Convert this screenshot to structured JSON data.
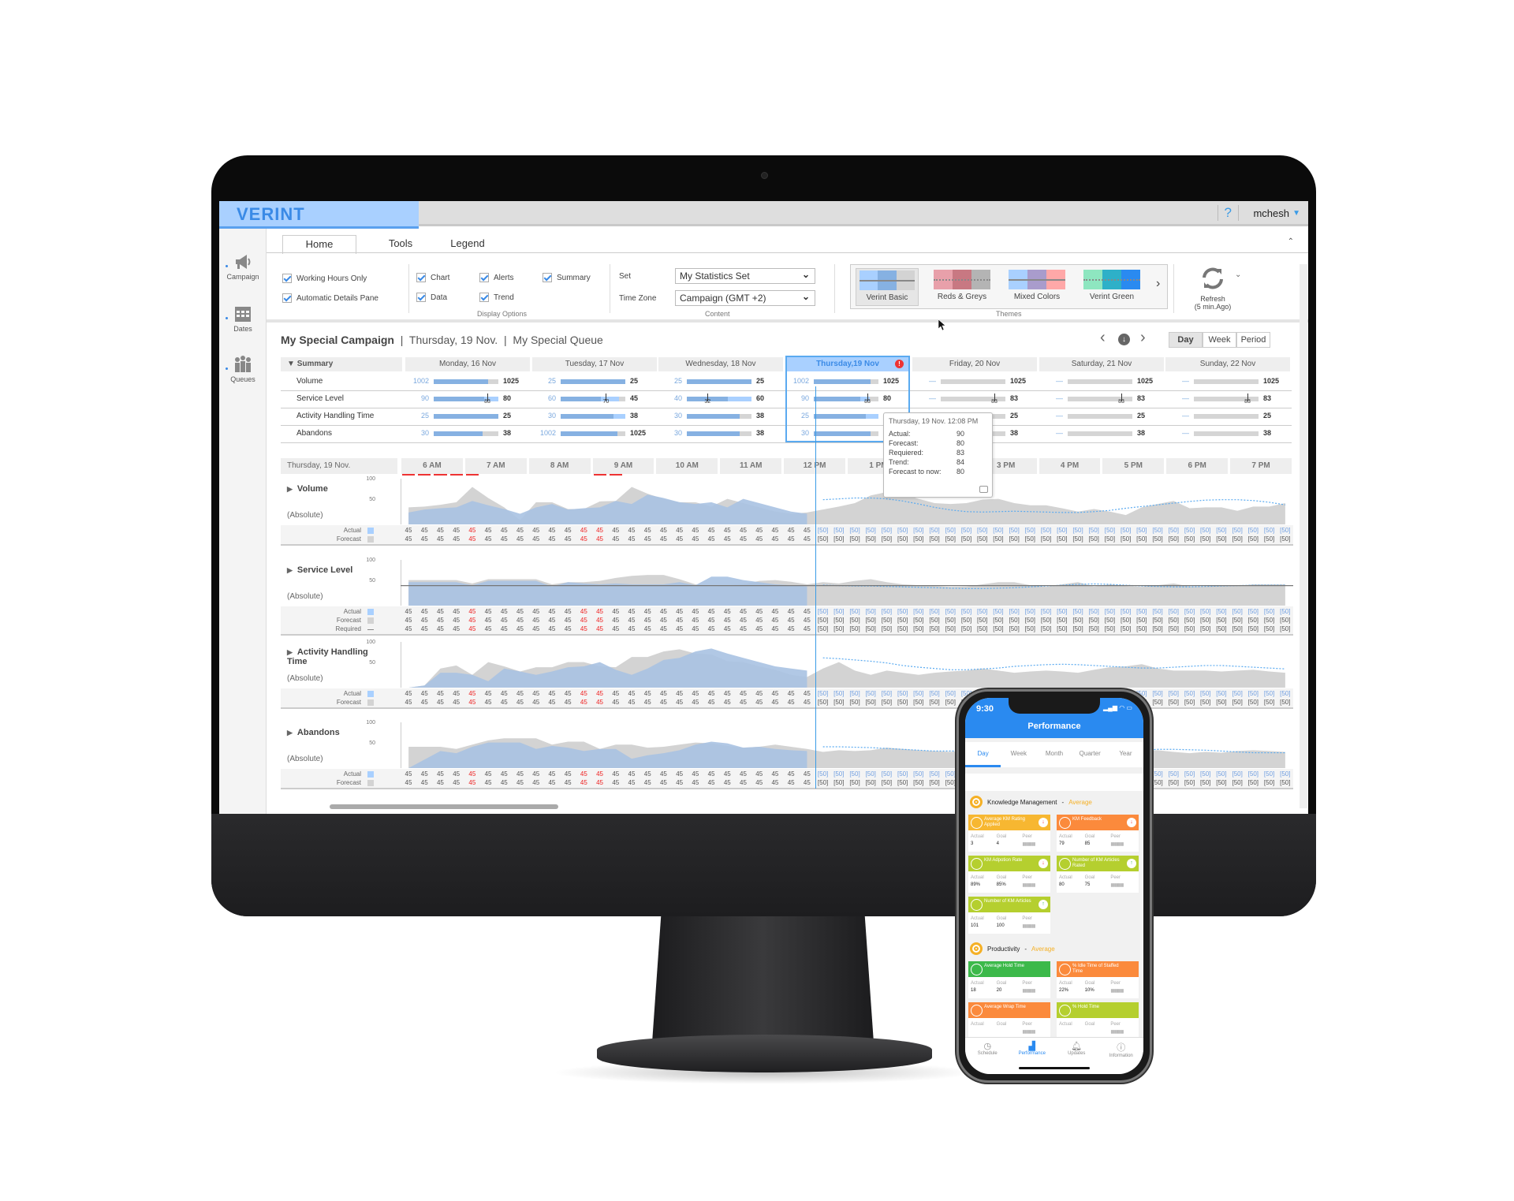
{
  "header": {
    "brand": "VERINT",
    "help": "?",
    "user": "mchesh"
  },
  "sidebar": {
    "items": [
      {
        "label": "Campaign",
        "icon": "megaphone-icon"
      },
      {
        "label": "Dates",
        "icon": "calendar-icon"
      },
      {
        "label": "Queues",
        "icon": "people-icon"
      }
    ]
  },
  "tabs": [
    {
      "label": "Home",
      "active": true
    },
    {
      "label": "Tools"
    },
    {
      "label": "Legend"
    }
  ],
  "options": {
    "working_hours": "Working Hours Only",
    "auto_details": "Automatic Details Pane",
    "display": {
      "chart": "Chart",
      "alerts": "Alerts",
      "summary": "Summary",
      "data": "Data",
      "trend": "Trend",
      "group": "Display Options"
    },
    "content": {
      "set_label": "Set",
      "set_value": "My Statistics Set",
      "tz_label": "Time Zone",
      "tz_value": "Campaign (GMT +2)",
      "group": "Content"
    },
    "themes": {
      "group": "Themes",
      "items": [
        {
          "name": "Verint Basic",
          "colors": [
            "#a9d0ff",
            "#86b1e2",
            "#d3d3d3"
          ],
          "selected": true
        },
        {
          "name": "Reds & Greys",
          "colors": [
            "#e8a0aa",
            "#c87882",
            "#b4b4b4"
          ]
        },
        {
          "name": "Mixed Colors",
          "colors": [
            "#a9d0ff",
            "#a99ccc",
            "#ffa8a8"
          ]
        },
        {
          "name": "Verint Green",
          "colors": [
            "#8ee6c0",
            "#2eb0c8",
            "#2a8af0"
          ]
        }
      ]
    },
    "refresh": {
      "label": "Refresh",
      "sub": "(5 min.Ago)"
    }
  },
  "title": {
    "campaign": "My Special Campaign",
    "date": "Thursday, 19 Nov.",
    "queue": "My Special Queue"
  },
  "view_buttons": [
    {
      "label": "Day",
      "active": true
    },
    {
      "label": "Week"
    },
    {
      "label": "Period"
    }
  ],
  "summary": {
    "label": "Summary",
    "days": [
      "Monday, 16 Nov",
      "Tuesday, 17 Nov",
      "Wednesday, 18 Nov",
      "Thursday,19 Nov",
      "Friday, 20 Nov",
      "Saturday, 21 Nov",
      "Sunday, 22 Nov"
    ],
    "selected_day": 3,
    "rows": [
      {
        "label": "Volume",
        "cells": [
          {
            "l": "1002",
            "r": "1025",
            "fill": 0.84
          },
          {
            "l": "25",
            "r": "25",
            "fill": 1
          },
          {
            "l": "25",
            "r": "25",
            "fill": 1
          },
          {
            "l": "1002",
            "r": "1025",
            "fill": 0.88
          },
          {
            "l": "—",
            "r": "1025",
            "fill": 0
          },
          {
            "l": "—",
            "r": "1025",
            "fill": 0
          },
          {
            "l": "—",
            "r": "1025",
            "fill": 0
          }
        ]
      },
      {
        "label": "Service Level",
        "cells": [
          {
            "l": "90",
            "r": "80",
            "fill": 0.78,
            "req": "83",
            "light": 1
          },
          {
            "l": "60",
            "r": "45",
            "fill": 0.62,
            "req": "70",
            "light": 0.9
          },
          {
            "l": "40",
            "r": "60",
            "fill": 0.64,
            "req": "32",
            "light": 1
          },
          {
            "l": "90",
            "r": "80",
            "fill": 0.72,
            "req": "83",
            "light": 0.86
          },
          {
            "l": "—",
            "r": "83",
            "fill": 0,
            "req": "83"
          },
          {
            "l": "—",
            "r": "83",
            "fill": 0,
            "req": "83"
          },
          {
            "l": "—",
            "r": "83",
            "fill": 0,
            "req": "83"
          }
        ]
      },
      {
        "label": "Activity Handling Time",
        "cells": [
          {
            "l": "25",
            "r": "25",
            "fill": 1
          },
          {
            "l": "30",
            "r": "38",
            "fill": 0.82,
            "light": 1
          },
          {
            "l": "30",
            "r": "38",
            "fill": 0.82
          },
          {
            "l": "25",
            "r": "25",
            "fill": 0.8,
            "light": 1
          },
          {
            "l": "—",
            "r": "25",
            "fill": 0
          },
          {
            "l": "—",
            "r": "25",
            "fill": 0
          },
          {
            "l": "—",
            "r": "25",
            "fill": 0
          }
        ]
      },
      {
        "label": "Abandons",
        "cells": [
          {
            "l": "30",
            "r": "38",
            "fill": 0.75
          },
          {
            "l": "1002",
            "r": "1025",
            "fill": 0.88
          },
          {
            "l": "30",
            "r": "38",
            "fill": 0.82
          },
          {
            "l": "30",
            "r": "38",
            "fill": 0.88
          },
          {
            "l": "—",
            "r": "38",
            "fill": 0
          },
          {
            "l": "—",
            "r": "38",
            "fill": 0
          },
          {
            "l": "—",
            "r": "38",
            "fill": 0
          }
        ]
      }
    ]
  },
  "tooltip": {
    "title": "Thursday, 19 Nov. 12:08 PM",
    "rows": [
      {
        "k": "Actual:",
        "v": "90"
      },
      {
        "k": "Forecast:",
        "v": "80"
      },
      {
        "k": "Requiered:",
        "v": "83"
      },
      {
        "k": "Trend:",
        "v": "84"
      },
      {
        "k": "Forecast to now:",
        "v": "80"
      }
    ]
  },
  "timeline": {
    "date": "Thursday, 19 Nov.",
    "hours": [
      "6 AM",
      "7 AM",
      "8 AM",
      "9 AM",
      "10 AM",
      "11 AM",
      "12 PM",
      "1 PM",
      "2 PM",
      "3 PM",
      "4 PM",
      "5 PM",
      "6 PM",
      "7 PM"
    ],
    "alert_intervals": [
      0,
      1,
      2,
      3,
      4,
      12,
      13
    ]
  },
  "data_rows": {
    "past": [
      "45",
      "45",
      "45",
      "45",
      "45",
      "45",
      "45",
      "45",
      "45",
      "45",
      "45",
      "45",
      "45",
      "45",
      "45",
      "45",
      "45",
      "45",
      "45",
      "45",
      "45",
      "45",
      "45",
      "45",
      "45",
      "45"
    ],
    "future": [
      "[50]",
      "[50]",
      "[50]",
      "[50]",
      "[50]",
      "[50]",
      "[50]",
      "[50]",
      "[50]",
      "[50]",
      "[50]",
      "[50]",
      "[50]",
      "[50]",
      "[50]",
      "[50]",
      "[50]",
      "[50]",
      "[50]",
      "[50]",
      "[50]",
      "[50]",
      "[50]",
      "[50]",
      "[50]",
      "[50]",
      "[50]",
      "[50]",
      "[50]",
      "[50]"
    ],
    "highlight_indices": [
      4,
      11,
      12
    ],
    "labels": {
      "actual": "Actual",
      "forecast": "Forecast",
      "required": "Required"
    }
  },
  "charts": [
    {
      "title": "Volume",
      "unit": "(Absolute)",
      "y_ticks": [
        "100",
        "50"
      ],
      "rows": [
        "actual",
        "forecast"
      ],
      "forecast": [
        40,
        42,
        46,
        52,
        88,
        62,
        40,
        10,
        52,
        52,
        36,
        36,
        54,
        55,
        88,
        72,
        60,
        52,
        52,
        42,
        60,
        50,
        40,
        30,
        25,
        28,
        35,
        42,
        50,
        68,
        76,
        72,
        60,
        50,
        48,
        50,
        58,
        60,
        50,
        45,
        45,
        38,
        30,
        36,
        30,
        22,
        40,
        48,
        55,
        38,
        40,
        40,
        32,
        42,
        42,
        50
      ],
      "actual": [
        28,
        35,
        38,
        40,
        55,
        45,
        36,
        25,
        40,
        48,
        35,
        38,
        40,
        55,
        48,
        70,
        62,
        52,
        48,
        52,
        40,
        60,
        50,
        40,
        30,
        25
      ],
      "trend": [
        58,
        60,
        62,
        62,
        60,
        55,
        48,
        40,
        34,
        30,
        29,
        30,
        31,
        30,
        29,
        28,
        28,
        30,
        33,
        38,
        42,
        46,
        50,
        54,
        57,
        58,
        58,
        56,
        52,
        46
      ]
    },
    {
      "title": "Service Level",
      "unit": "(Absolute)",
      "y_ticks": [
        "100",
        "50"
      ],
      "rows": [
        "actual",
        "forecast",
        "required"
      ],
      "required_level": 47,
      "forecast": [
        60,
        60,
        60,
        60,
        52,
        62,
        62,
        62,
        62,
        50,
        55,
        55,
        58,
        65,
        70,
        72,
        72,
        62,
        50,
        45,
        48,
        50,
        58,
        60,
        56,
        50,
        55,
        52,
        58,
        62,
        55,
        50,
        48,
        46,
        44,
        45,
        50,
        55,
        55,
        48,
        44,
        50,
        55,
        45,
        50,
        46,
        44,
        48,
        52,
        45,
        45,
        48,
        46,
        50,
        50,
        50
      ],
      "actual": [
        55,
        55,
        55,
        55,
        48,
        58,
        58,
        58,
        58,
        45,
        55,
        52,
        50,
        52,
        50,
        50,
        50,
        55,
        48,
        68,
        68,
        60,
        55,
        50,
        48,
        45
      ],
      "trend": [
        48,
        47,
        46,
        46,
        45,
        44,
        43,
        42,
        41,
        40,
        40,
        41,
        42,
        44,
        46,
        48,
        50,
        51,
        50,
        48,
        46,
        45,
        44,
        44,
        45,
        46,
        47,
        48,
        48,
        48
      ]
    },
    {
      "title": "Activity Handling Time",
      "unit": "(Absolute)",
      "y_ticks": [
        "100",
        "50"
      ],
      "rows": [
        "actual",
        "forecast"
      ],
      "forecast": [
        0,
        5,
        45,
        52,
        30,
        60,
        50,
        38,
        48,
        48,
        60,
        60,
        50,
        48,
        72,
        72,
        85,
        90,
        80,
        78,
        62,
        60,
        50,
        42,
        30,
        25,
        45,
        60,
        40,
        30,
        40,
        35,
        30,
        35,
        38,
        40,
        45,
        40,
        35,
        38,
        40,
        38,
        35,
        42,
        48,
        50,
        55,
        45,
        40,
        40,
        40,
        38,
        40,
        42,
        38,
        35
      ],
      "actual": [
        0,
        5,
        35,
        35,
        30,
        15,
        45,
        38,
        30,
        38,
        48,
        50,
        60,
        42,
        30,
        45,
        65,
        70,
        85,
        92,
        80,
        70,
        60,
        50,
        45,
        40
      ],
      "trend": [
        70,
        68,
        65,
        62,
        58,
        52,
        48,
        45,
        42,
        42,
        44,
        46,
        50,
        52,
        54,
        55,
        54,
        52,
        50,
        48,
        46,
        46,
        48,
        50,
        52,
        52,
        50,
        48,
        46,
        44
      ]
    },
    {
      "title": "Abandons",
      "unit": "(Absolute)",
      "y_ticks": [
        "100",
        "50"
      ],
      "rows": [
        "actual",
        "forecast"
      ],
      "forecast": [
        50,
        50,
        50,
        45,
        55,
        65,
        70,
        70,
        70,
        55,
        62,
        62,
        45,
        55,
        55,
        48,
        50,
        55,
        60,
        58,
        52,
        48,
        50,
        55,
        50,
        45,
        38,
        42,
        40,
        42,
        48,
        45,
        42,
        40,
        38,
        42,
        44,
        40,
        38,
        38,
        42,
        45,
        48,
        40,
        38,
        36,
        40,
        42,
        38,
        35,
        38,
        36,
        40,
        42,
        40,
        38
      ],
      "actual": [
        0,
        20,
        40,
        35,
        50,
        60,
        60,
        60,
        45,
        52,
        48,
        40,
        45,
        45,
        22,
        30,
        35,
        42,
        55,
        62,
        58,
        48,
        50,
        45,
        42,
        40
      ],
      "trend": [
        50,
        50,
        49,
        48,
        46,
        44,
        42,
        40,
        40,
        40,
        41,
        42,
        42,
        41,
        40,
        39,
        38,
        38,
        39,
        40,
        42,
        44,
        44,
        43,
        42,
        40,
        38,
        36,
        36,
        36
      ]
    }
  ],
  "phone": {
    "time": "9:30",
    "title": "Performance",
    "tabs": [
      {
        "label": "Day",
        "active": true
      },
      {
        "label": "Week"
      },
      {
        "label": "Month"
      },
      {
        "label": "Quarter"
      },
      {
        "label": "Year"
      }
    ],
    "metric_labels": {
      "actual": "Actual",
      "goal": "Goal",
      "peer": "Peer"
    },
    "sections": [
      {
        "title": "Knowledge Management",
        "rating": "Average",
        "cards": [
          {
            "name": "Average KM Rating Applied",
            "color": "#f7b731",
            "trend": "down",
            "actual": "3",
            "goal": "4"
          },
          {
            "name": "KM Feedback",
            "color": "#fb8a3c",
            "trend": "down",
            "actual": "79",
            "goal": "85"
          },
          {
            "name": "KM Adpotion Rate",
            "color": "#b5cf2f",
            "trend": "down",
            "actual": "89%",
            "goal": "85%"
          },
          {
            "name": "Number of KM Articles Rated",
            "color": "#b5cf2f",
            "trend": "up",
            "actual": "80",
            "goal": "75"
          },
          {
            "name": "Number of KM Articles",
            "color": "#b5cf2f",
            "trend": "up",
            "actual": "101",
            "goal": "100"
          }
        ]
      },
      {
        "title": "Productivity",
        "rating": "Average",
        "cards": [
          {
            "name": "Average Hold Time",
            "color": "#3cb94a",
            "trend": "",
            "actual": "18",
            "goal": "20"
          },
          {
            "name": "% Idle Time of Staffed Time",
            "color": "#fb8a3c",
            "trend": "",
            "actual": "22%",
            "goal": "10%"
          },
          {
            "name": "Average Wrap Time",
            "color": "#fb8a3c",
            "trend": "",
            "actual": "",
            "goal": ""
          },
          {
            "name": "% Hold Time",
            "color": "#b5cf2f",
            "trend": "",
            "actual": "",
            "goal": ""
          }
        ]
      }
    ],
    "nav": [
      {
        "label": "Schedule",
        "icon": "schedule-icon"
      },
      {
        "label": "Performance",
        "icon": "chart-icon",
        "active": true
      },
      {
        "label": "Updates",
        "icon": "bell-icon"
      },
      {
        "label": "Information",
        "icon": "info-icon"
      }
    ]
  },
  "colors": {
    "accent": "#3a8ae6",
    "actual": "#a9d0ff",
    "forecast": "#d3d3d3",
    "alert": "#e33333",
    "phone_header": "#2a8af0"
  }
}
